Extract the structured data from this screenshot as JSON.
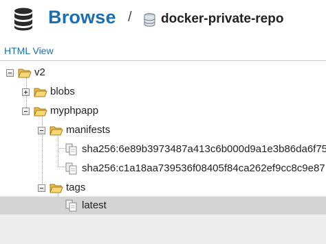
{
  "header": {
    "title": "Browse",
    "separator": "/",
    "repository": "docker-private-repo"
  },
  "view_link": "HTML View",
  "tree": {
    "root": "v2",
    "blobs": "blobs",
    "myphpapp": "myphpapp",
    "manifests": "manifests",
    "manifest_1": "sha256:6e89b3973487a413c6b000d9a1e3b86da6f75",
    "manifest_2": "sha256:c1a18aa739536f08405f84ca262ef9cc8c9e87",
    "tags": "tags",
    "tag_latest": "latest"
  },
  "colors": {
    "brand": "#1a6fb3",
    "selected_row": "#d4d4d4",
    "folder_fill": "#f4d06b"
  },
  "icons": {
    "header": "database-icon",
    "repository": "database-icon",
    "folder": "open-folder-icon",
    "file": "document-stack-icon",
    "expander": "tree-toggle-icon"
  }
}
